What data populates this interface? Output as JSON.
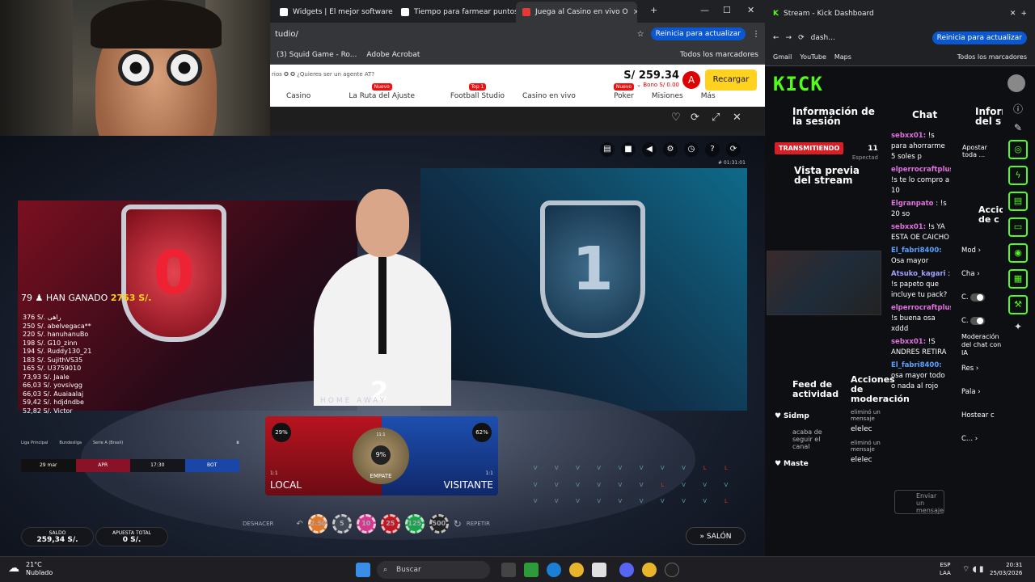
{
  "browser_left": {
    "tabs": [
      {
        "label": "Widgets | El mejor software p",
        "color": "#ffffff"
      },
      {
        "label": "Tiempo para farmear puntos",
        "color": "#ffffff"
      },
      {
        "label": "Juega al Casino en vivo O",
        "color": "#e53935"
      }
    ],
    "url": "tudio/",
    "update_label": "Reinicia para actualizar",
    "bookmarks": [
      "(3) Squid Game - Ro...",
      "Adobe Acrobat",
      "Todos los marcadores"
    ]
  },
  "site": {
    "agent_text": "rios ✪ ✪  ¿Quieres ser un agente AT?",
    "nav": [
      {
        "label": "Casino",
        "badge": ""
      },
      {
        "label": "La Ruta del Ajuste",
        "badge": "Nuevo"
      },
      {
        "label": "Football Studio",
        "badge": "Top 1"
      },
      {
        "label": "Casino en vivo",
        "badge": ""
      },
      {
        "label": "Poker",
        "badge": "Nuevo"
      },
      {
        "label": "Misiones",
        "badge": ""
      },
      {
        "label": "Más",
        "badge": ""
      }
    ],
    "balance": "S/ 259.34",
    "bono": "⌄ Bono S/ 0.00",
    "avatar_letter": "A",
    "recharge_label": "Recargar"
  },
  "game": {
    "timer": "# 01:31:01",
    "winners_count": "79 ♟",
    "winners_text": "HAN GANADO",
    "winners_amount": "2763 S/.",
    "winners": [
      "376 S/.  راهی",
      "250 S/.  abelvegaca**",
      "220 S/.  hanuhanuBo",
      "198 S/.  G10_zinn",
      "194 S/.  Ruddy130_21",
      "183 S/.  SujithVS35",
      "165 S/.  U3759010",
      "73,93 S/.  Jaale",
      "66,03 S/.  yovsivgg",
      "66,03 S/.  Auaiaalaj",
      "59,42 S/.  hdjdndbe",
      "52,82 S/.  Victor"
    ],
    "leagues": [
      "Liga Principal",
      "Bundesliga",
      "Serie A (Brasil)"
    ],
    "match": [
      "29 mar",
      "APR",
      "17:30",
      "BOT"
    ],
    "countdown": "2",
    "home_away": "HOME   AWAY",
    "shield_left": "0",
    "shield_right": "1",
    "local": {
      "label": "LOCAL",
      "ratio": "1:1",
      "pct": "29%"
    },
    "visitor": {
      "label": "VISITANTE",
      "ratio": "1:1",
      "pct": "62%"
    },
    "tie": {
      "label": "EMPATE",
      "ratio": "11:1",
      "pct": "9%"
    },
    "deshacer": "DESHACER",
    "repetir": "REPETIR",
    "chips": [
      {
        "value": "2.50",
        "color": "#e07a2a"
      },
      {
        "value": "5",
        "color": "#444a55"
      },
      {
        "value": "10",
        "color": "#d43a8c"
      },
      {
        "value": "25",
        "color": "#c01822"
      },
      {
        "value": "125",
        "color": "#1aa34a"
      },
      {
        "value": "500",
        "color": "#222222"
      }
    ],
    "saldo_label": "SALDO",
    "saldo_value": "259,34 S/.",
    "apuesta_label": "APUESTA TOTAL",
    "apuesta_value": "0 S/.",
    "salon_label": "SALÓN",
    "side_grid": [
      "V",
      "V",
      "V",
      "V",
      "V",
      "V",
      "V",
      "V",
      "L",
      "L",
      "V",
      "V",
      "V",
      "V",
      "V",
      "V",
      "L",
      "V",
      "V",
      "V",
      "V",
      "V",
      "V",
      "V",
      "V",
      "V",
      "V",
      "V",
      "V",
      "L"
    ]
  },
  "kick": {
    "tab_label": "Stream - Kick Dashboard",
    "url": "dash...",
    "update_label": "Reinicia para actualizar",
    "bookmarks": [
      "Gmail",
      "YouTube",
      "Maps",
      "Todos los marcadores"
    ],
    "logo": "KICK",
    "session_title": "Información de la sesión",
    "live_badge": "TRANSMITIENDO",
    "viewers": "11",
    "expected": "Espectad",
    "preview_title": "Vista previa del stream",
    "feed_title": "Feed de actividad",
    "actions_title": "Acciones de moderación",
    "feed_items": [
      "Sidmp",
      "acaba de seguir el canal",
      "Maste"
    ],
    "action_items": [
      "eliminó un mensaje",
      "elelec",
      "eliminó un mensaje",
      "elelec"
    ],
    "chat_title": "Chat",
    "chat": [
      {
        "user": "sebxx01:",
        "text": "!s para ahorrarme 5 soles p",
        "color": "#e070e0"
      },
      {
        "user": "elperrocraftplusxi:",
        "text": "!s te lo compro a 10",
        "color": "#e070e0"
      },
      {
        "user": "Elgranpato",
        "text": ": !s 20 so",
        "color": "#e070e0"
      },
      {
        "user": "sebxx01:",
        "text": "!s YA ESTA OE CAICHO",
        "color": "#e070e0"
      },
      {
        "user": "El_fabri8400:",
        "text": "Osa mayor",
        "color": "#5aa0ff"
      },
      {
        "user": "Atsuko_kagari",
        "text": ": !s papeto que incluye tu pack?",
        "color": "#a0a0ff"
      },
      {
        "user": "elperrocraftplusxi:",
        "text": "!s buena osa xddd",
        "color": "#e070e0"
      },
      {
        "user": "sebxx01:",
        "text": "!S ANDRES RETIRA",
        "color": "#e070e0"
      },
      {
        "user": "El_fabri8400:",
        "text": "osa mayor todo o nada al rojo",
        "color": "#5aa0ff"
      }
    ],
    "send_placeholder": "Enviar un mensaje",
    "info_title": "Información del s",
    "apostar_text": "Apostar toda ...",
    "acc_title": "Acciones de c",
    "mod_items": [
      "Mod",
      "Cha",
      "C.",
      "C.",
      "Moderación del chat con IA",
      "Res",
      "Pala",
      "Hostear c",
      "C..."
    ]
  },
  "taskbar": {
    "weather_temp": "21°C",
    "weather_text": "Nublado",
    "search_placeholder": "Buscar",
    "lang": "ESP",
    "lang2": "LAA",
    "time": "20:31",
    "date": "25/03/2026"
  }
}
